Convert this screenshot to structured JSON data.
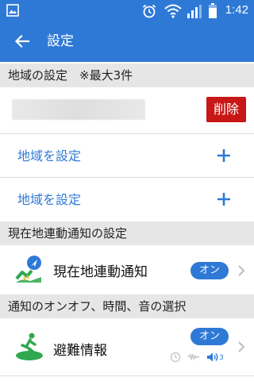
{
  "status_bar": {
    "time": "1:42",
    "icons": [
      "image-icon",
      "alarm-icon",
      "wifi-icon",
      "signal-icon",
      "battery-icon"
    ]
  },
  "app_bar": {
    "title": "設定",
    "back_icon": "arrow-left-icon"
  },
  "region_settings": {
    "header": "地域の設定　※最大3件",
    "delete_label": "削除",
    "add_rows": [
      {
        "label": "地域を設定"
      },
      {
        "label": "地域を設定"
      }
    ]
  },
  "location_section": {
    "header": "現在地連動通知の設定",
    "item": {
      "label": "現在地連動通知",
      "badge": "オン"
    }
  },
  "notification_section": {
    "header": "通知のオンオフ、時間、音の選択",
    "item": {
      "label": "避難情報",
      "badge": "オン",
      "sound_level": "3"
    }
  },
  "colors": {
    "primary": "#2f79d6",
    "delete": "#c81717",
    "section_bg": "#e6e6e6",
    "icon_green": "#2fa84f"
  }
}
